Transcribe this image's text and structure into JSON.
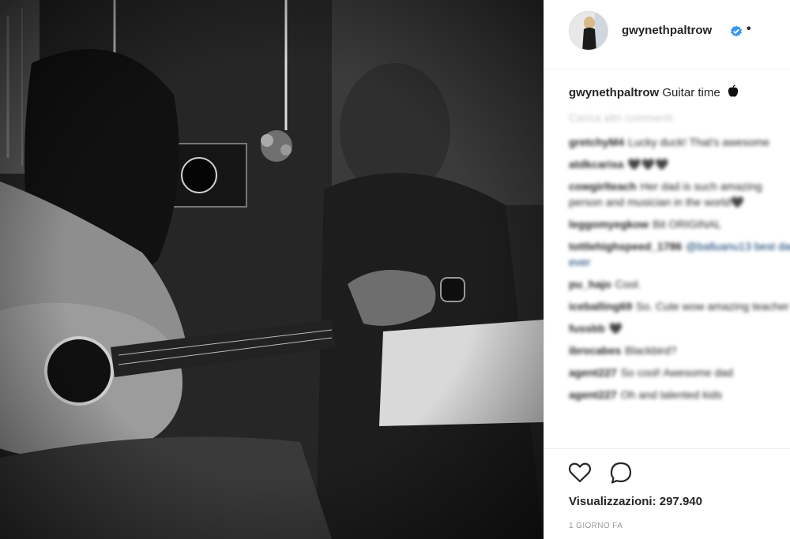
{
  "post": {
    "username": "gwynethpaltrow",
    "separator": "•",
    "caption_user": "gwynethpaltrow",
    "caption_text": "Guitar time",
    "caption_emoji": "black-apple-icon",
    "load_more": "Carica altri commenti",
    "comments": [
      {
        "user": "gretchyM4",
        "text": "Lucky duck! That's awesome"
      },
      {
        "user": "atdkcarisa",
        "text": "🖤🖤🖤"
      },
      {
        "user": "cowgirlteach",
        "text": "Her dad is such amazing person and musician in the world🖤"
      },
      {
        "user": "leggomyegkow",
        "text": "Bit ORIGINAL"
      },
      {
        "user": "tottlehighspeed_1786",
        "text": "@balluanu13 best dad ever"
      },
      {
        "user": "pu_hajo",
        "text": "Cool."
      },
      {
        "user": "iceballing69",
        "text": "So. Cute wow amazing teacher"
      },
      {
        "user": "fussbb",
        "text": "🖤"
      },
      {
        "user": "ibrocabes",
        "text": "Blackbird?"
      },
      {
        "user": "agent227",
        "text": "So cool! Awesome dad"
      },
      {
        "user": "agent227",
        "text": "Oh and talented kids"
      }
    ],
    "views_label": "Visualizzazioni: 297.940",
    "timestamp": "1 GIORNO FA"
  },
  "icons": {
    "like": "heart-icon",
    "comment": "comment-bubble-icon",
    "verified": "verified-badge-icon"
  },
  "colors": {
    "verified": "#3897f0",
    "border": "#efefef",
    "muted": "#999999"
  }
}
